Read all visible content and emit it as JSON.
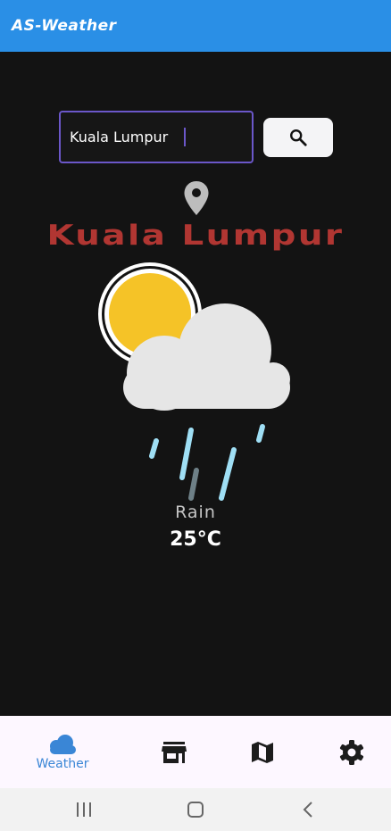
{
  "app": {
    "title": "AS-Weather"
  },
  "search": {
    "value": "Kuala Lumpur"
  },
  "location": {
    "city": "Kuala Lumpur"
  },
  "weather": {
    "condition": "Rain",
    "temperature": "25°C"
  },
  "nav": {
    "items": [
      {
        "label": "Weather",
        "icon": "cloud-icon",
        "active": true
      },
      {
        "label": "",
        "icon": "store-icon",
        "active": false
      },
      {
        "label": "",
        "icon": "map-icon",
        "active": false
      },
      {
        "label": "",
        "icon": "gear-icon",
        "active": false
      }
    ]
  },
  "colors": {
    "appbar": "#2a8fe6",
    "city": "#b13632",
    "accent": "#6b57c9",
    "nav_active": "#3a86d6"
  }
}
